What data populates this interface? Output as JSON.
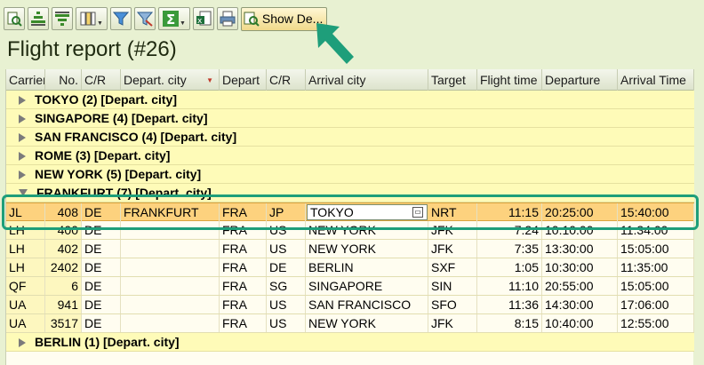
{
  "toolbar": {
    "buttons": [
      {
        "name": "details-icon"
      },
      {
        "name": "sort-ascending-icon"
      },
      {
        "name": "sort-descending-icon"
      },
      {
        "name": "columns-icon",
        "dropdown": true
      },
      {
        "name": "filter-icon"
      },
      {
        "name": "delete-filter-icon"
      },
      {
        "name": "sum-icon",
        "dropdown": true
      },
      {
        "name": "export-icon"
      },
      {
        "name": "print-icon"
      }
    ],
    "show_details_label": "Show De..."
  },
  "title": "Flight report (#26)",
  "columns": [
    "Carrier",
    "No.",
    "C/R",
    "Depart. city",
    "Depart",
    "C/R",
    "Arrival city",
    "Target",
    "Flight time",
    "Departure",
    "Arrival Time"
  ],
  "groups_before": [
    "TOKYO (2) [Depart. city]",
    "SINGAPORE (4) [Depart. city]",
    "SAN FRANCISCO (4) [Depart. city]",
    "ROME (3) [Depart. city]",
    "NEW YORK (5) [Depart. city]",
    "FRANKFURT (7) [Depart. city]"
  ],
  "rows": [
    {
      "carrier": "JL",
      "no": "408",
      "cr": "DE",
      "dep_city": "FRANKFURT",
      "depart": "FRA",
      "cr2": "JP",
      "arr_city": "TOKYO",
      "target": "NRT",
      "flight_time": "11:15",
      "departure": "20:25:00",
      "arrival": "15:40:00"
    },
    {
      "carrier": "LH",
      "no": "400",
      "cr": "DE",
      "dep_city": "",
      "depart": "FRA",
      "cr2": "US",
      "arr_city": "NEW YORK",
      "target": "JFK",
      "flight_time": "7:24",
      "departure": "10:10:00",
      "arrival": "11:34:00"
    },
    {
      "carrier": "LH",
      "no": "402",
      "cr": "DE",
      "dep_city": "",
      "depart": "FRA",
      "cr2": "US",
      "arr_city": "NEW YORK",
      "target": "JFK",
      "flight_time": "7:35",
      "departure": "13:30:00",
      "arrival": "15:05:00"
    },
    {
      "carrier": "LH",
      "no": "2402",
      "cr": "DE",
      "dep_city": "",
      "depart": "FRA",
      "cr2": "DE",
      "arr_city": "BERLIN",
      "target": "SXF",
      "flight_time": "1:05",
      "departure": "10:30:00",
      "arrival": "11:35:00"
    },
    {
      "carrier": "QF",
      "no": "6",
      "cr": "DE",
      "dep_city": "",
      "depart": "FRA",
      "cr2": "SG",
      "arr_city": "SINGAPORE",
      "target": "SIN",
      "flight_time": "11:10",
      "departure": "20:55:00",
      "arrival": "15:05:00"
    },
    {
      "carrier": "UA",
      "no": "941",
      "cr": "DE",
      "dep_city": "",
      "depart": "FRA",
      "cr2": "US",
      "arr_city": "SAN FRANCISCO",
      "target": "SFO",
      "flight_time": "11:36",
      "departure": "14:30:00",
      "arrival": "17:06:00"
    },
    {
      "carrier": "UA",
      "no": "3517",
      "cr": "DE",
      "dep_city": "",
      "depart": "FRA",
      "cr2": "US",
      "arr_city": "NEW YORK",
      "target": "JFK",
      "flight_time": "8:15",
      "departure": "10:40:00",
      "arrival": "12:55:00"
    }
  ],
  "groups_after": [
    "BERLIN (1) [Depart. city]"
  ],
  "colors": {
    "highlight_frame": "#1e9e7a",
    "selected_row": "#fdd27e",
    "group_row": "#fefbb8"
  }
}
